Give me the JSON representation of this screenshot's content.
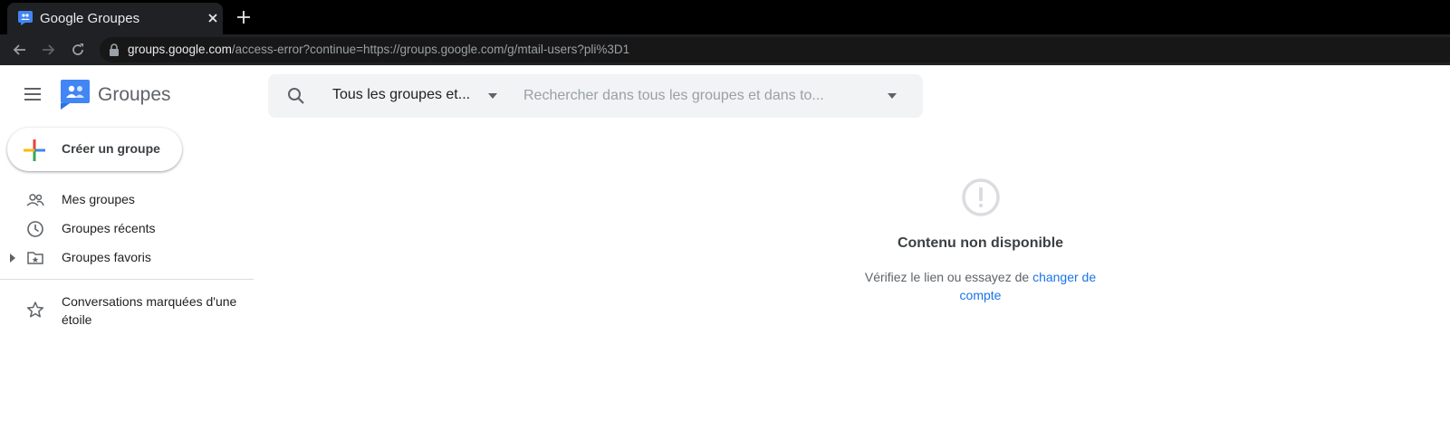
{
  "browser": {
    "tab_title": "Google Groupes",
    "url_host": "groups.google.com",
    "url_path": "/access-error?continue=https://groups.google.com/g/mtail-users?pli%3D1"
  },
  "app": {
    "logo_text": "Groupes",
    "create_button_label": "Créer un groupe"
  },
  "sidebar": {
    "items": [
      {
        "label": "Mes groupes",
        "icon": "people-icon"
      },
      {
        "label": "Groupes récents",
        "icon": "clock-icon"
      },
      {
        "label": "Groupes favoris",
        "icon": "folder-star-icon"
      }
    ],
    "starred_label": "Conversations marquées d'une étoile"
  },
  "search": {
    "scope_label": "Tous les groupes et...",
    "placeholder": "Rechercher dans tous les groupes et dans to..."
  },
  "error": {
    "title": "Contenu non disponible",
    "text_prefix": "Vérifiez le lien ou essayez de ",
    "link_label": "changer de compte"
  },
  "colors": {
    "link": "#1a73e8",
    "brand_blue": "#4285f4"
  }
}
